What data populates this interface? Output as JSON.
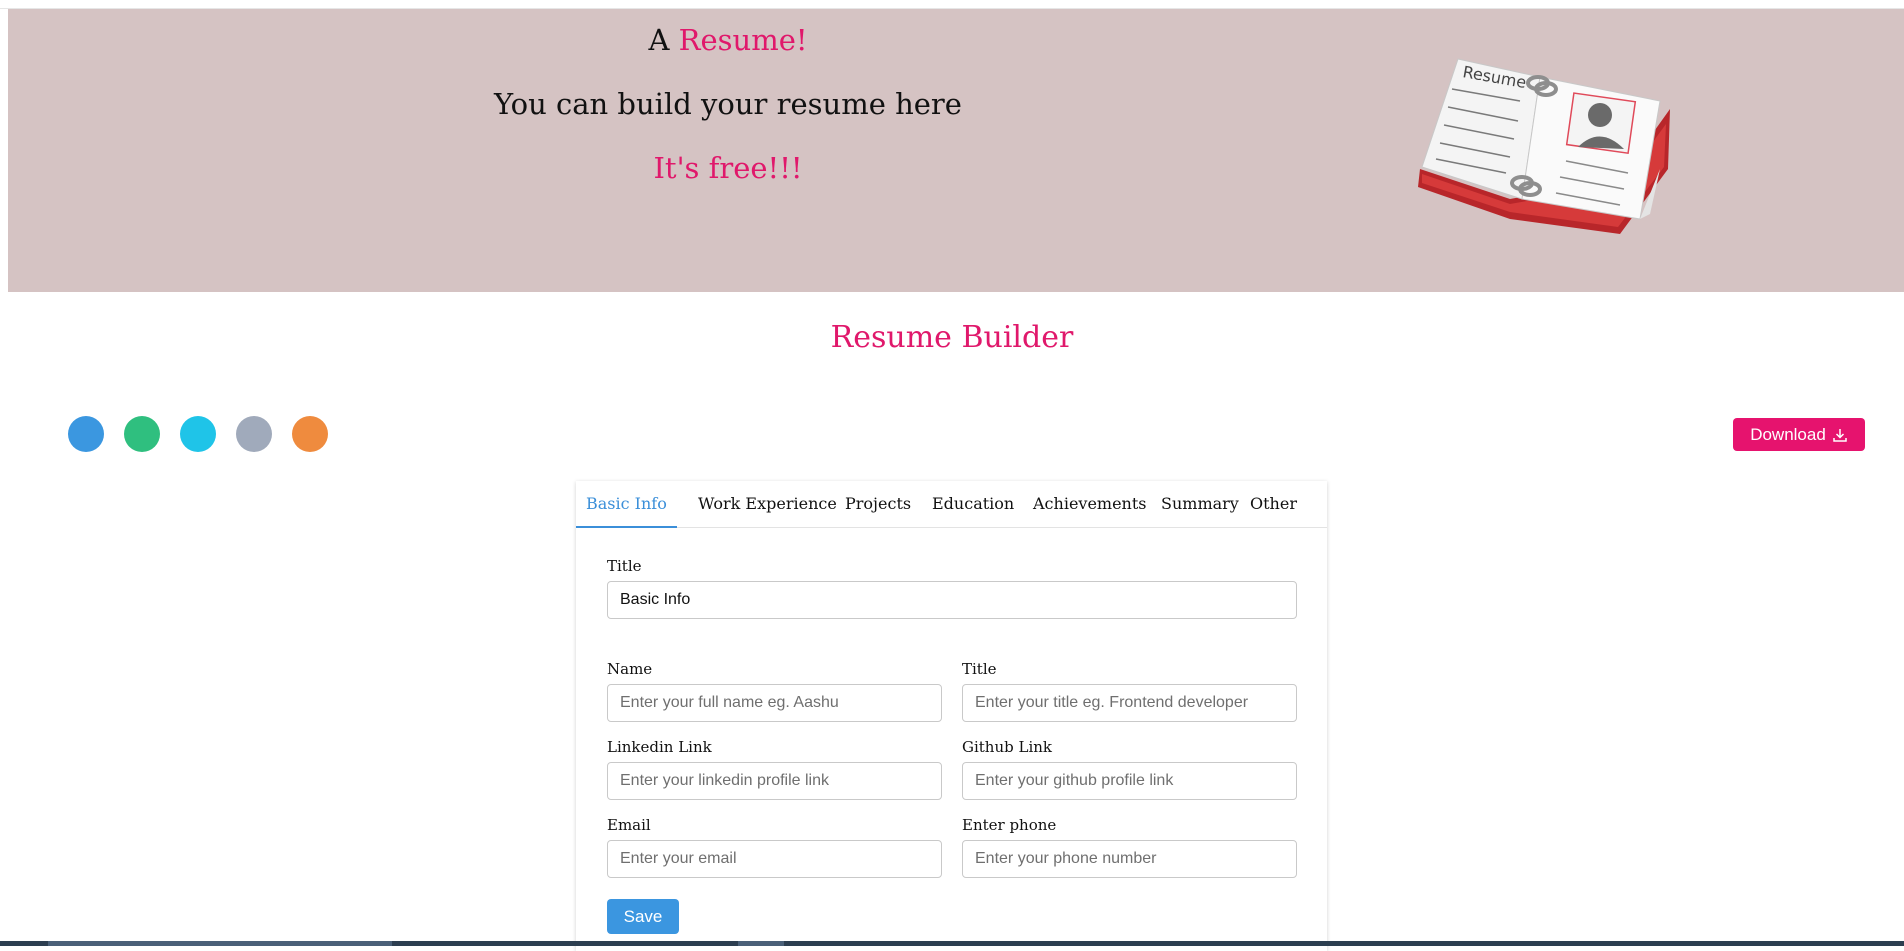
{
  "hero": {
    "line1_prefix": "A",
    "line1_highlight": "Resume!",
    "line2": "You can build your resume here",
    "line3": "It's free!!!",
    "image_label": "Resume"
  },
  "page_title": "Resume Builder",
  "colors": {
    "hero_bg": "#d5c3c3",
    "accent_pink": "#e0186b",
    "accent_blue": "#3b8fd9"
  },
  "theme_swatches": [
    {
      "name": "blue",
      "color": "#3b97e0"
    },
    {
      "name": "green",
      "color": "#2fbf7f"
    },
    {
      "name": "cyan",
      "color": "#1fc4e8"
    },
    {
      "name": "gray",
      "color": "#a0aabb"
    },
    {
      "name": "orange",
      "color": "#ef8b3e"
    }
  ],
  "download_label": "Download",
  "tabs": [
    "Basic Info",
    "Work Experience",
    "Projects",
    "Education",
    "Achievements",
    "Summary",
    "Other"
  ],
  "active_tab": "Basic Info",
  "form": {
    "section_title_label": "Title",
    "section_title_value": "Basic Info",
    "name_label": "Name",
    "name_placeholder": "Enter your full name eg. Aashu",
    "title_label": "Title",
    "title_placeholder": "Enter your title eg. Frontend developer",
    "linkedin_label": "Linkedin Link",
    "linkedin_placeholder": "Enter your linkedin profile link",
    "github_label": "Github Link",
    "github_placeholder": "Enter your github profile link",
    "email_label": "Email",
    "email_placeholder": "Enter your email",
    "phone_label": "Enter phone",
    "phone_placeholder": "Enter your phone number",
    "save_label": "Save"
  }
}
